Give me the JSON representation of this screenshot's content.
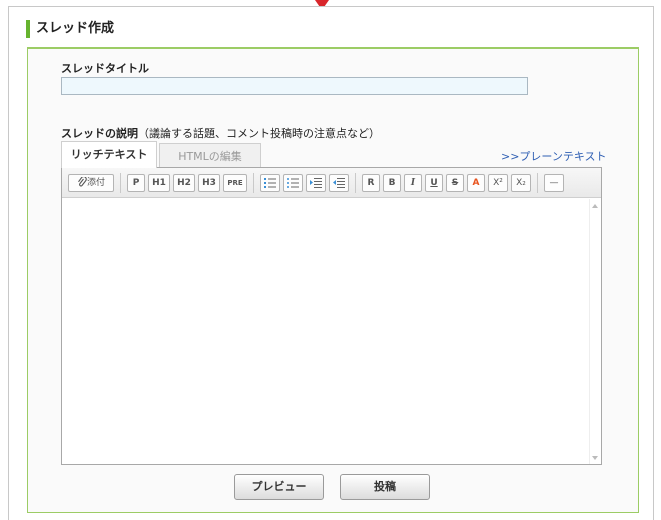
{
  "header": {
    "title": "スレッド作成"
  },
  "form": {
    "title_label": "スレッドタイトル",
    "title_value": "",
    "desc_label_bold": "スレッドの説明",
    "desc_label_note": "（議論する話題、コメント投稿時の注意点など）",
    "body_value": ""
  },
  "tabs": {
    "rich_text": "リッチテキスト",
    "html_edit": "HTMLの編集"
  },
  "plain_text_link": ">>プレーンテキスト",
  "toolbar": {
    "attach": "添付",
    "p": "P",
    "h1": "H1",
    "h2": "H2",
    "h3": "H3",
    "pre": "PRE",
    "remove": "R",
    "bold": "B",
    "italic": "I",
    "underline": "U",
    "strike": "S",
    "color": "A",
    "sup": "X²",
    "sub": "X₂",
    "hr": "—"
  },
  "buttons": {
    "preview": "プレビュー",
    "submit": "投稿"
  },
  "colors": {
    "accent_green": "#66b32e",
    "panel_border": "#9ccc65",
    "link_blue": "#2f5fb3",
    "arrow_red": "#d8262b"
  }
}
